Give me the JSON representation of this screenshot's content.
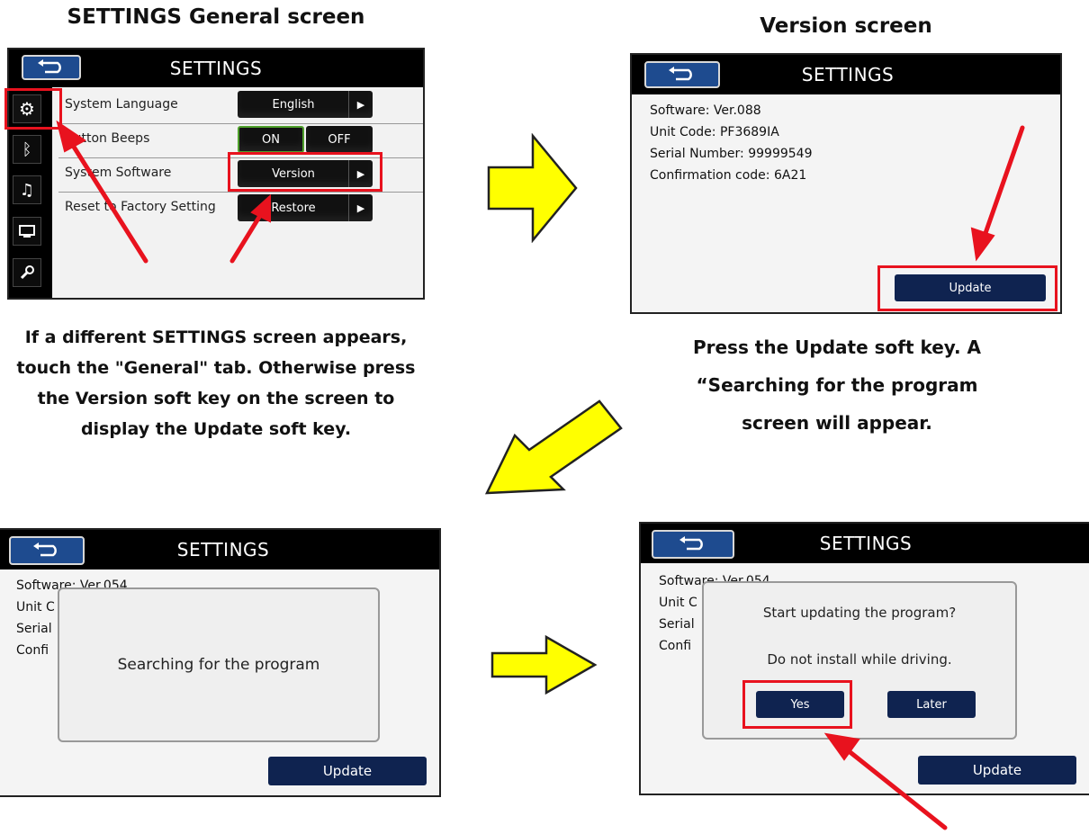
{
  "top_left": {
    "heading": "SETTINGS General screen",
    "screen_title": "SETTINGS",
    "rows": [
      {
        "label": "System Language",
        "button": "English"
      },
      {
        "label": "Button Beeps",
        "on": "ON",
        "off": "OFF"
      },
      {
        "label": "System Software",
        "button": "Version"
      },
      {
        "label": "Reset to Factory Setting",
        "button": "Restore"
      }
    ],
    "side_icons": [
      "gear-icon",
      "bluetooth-icon",
      "music-icon",
      "screen-icon",
      "wrench-icon"
    ],
    "caption_lines": [
      "If a different SETTINGS screen appears,",
      "touch the \"General\" tab.  Otherwise press",
      "the Version soft key on the screen to",
      "display the Update soft key."
    ]
  },
  "top_right": {
    "heading": "Version screen",
    "screen_title": "SETTINGS",
    "info": [
      "Software: Ver.088",
      "Unit Code: PF3689IA",
      "Serial Number: 99999549",
      "Confirmation code: 6A21"
    ],
    "update_label": "Update",
    "caption_lines": [
      "Press the Update soft key.  A",
      "“Searching for the program",
      "screen will appear."
    ]
  },
  "bottom_left": {
    "screen_title": "SETTINGS",
    "info_partial": [
      "Software: Ver.054",
      "Unit C",
      "Serial",
      "Confi"
    ],
    "dialog_text": "Searching for the program",
    "update_label": "Update"
  },
  "bottom_right": {
    "screen_title": "SETTINGS",
    "info_partial": [
      "Software: Ver.054",
      "Unit C",
      "Serial",
      "Confi"
    ],
    "dialog_line1": "Start updating the program?",
    "dialog_line2": "Do not install while driving.",
    "yes_label": "Yes",
    "later_label": "Later",
    "update_label": "Update"
  },
  "colors": {
    "arrow_fill": "#ffff00",
    "highlight_red": "#e8121e",
    "button_navy": "#0f2350",
    "back_button_blue": "#1e4b8f"
  }
}
